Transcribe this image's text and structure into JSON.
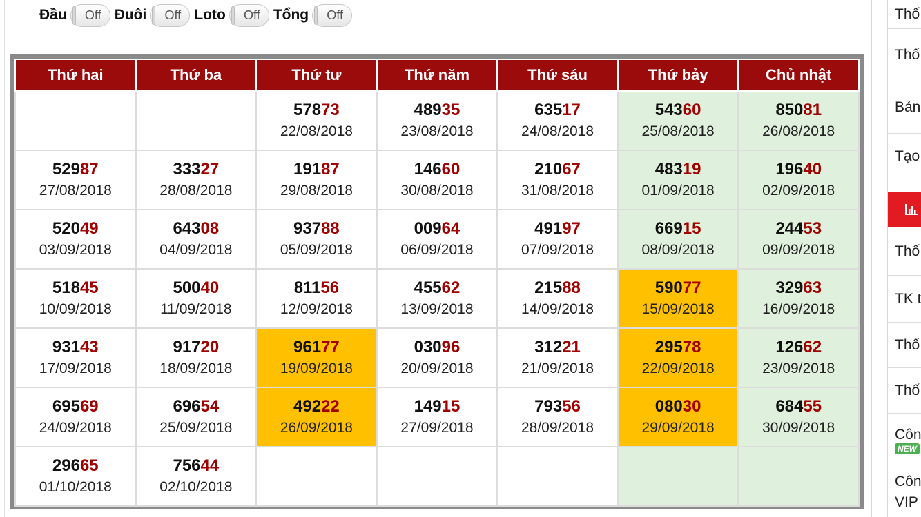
{
  "toggles": [
    {
      "label": "Đầu",
      "state": "Off"
    },
    {
      "label": "Đuôi",
      "state": "Off"
    },
    {
      "label": "Loto",
      "state": "Off"
    },
    {
      "label": "Tổng",
      "state": "Off"
    }
  ],
  "calendar": {
    "headers": [
      "Thứ hai",
      "Thứ ba",
      "Thứ tư",
      "Thứ năm",
      "Thứ sáu",
      "Thứ bảy",
      "Chủ nhật"
    ],
    "colors": {
      "header_bg": "#9b0b0b",
      "weekend_bg": "#dff0dc",
      "highlight_bg": "#ffc000",
      "tail_color": "#a00000"
    },
    "rows": [
      [
        null,
        null,
        {
          "head": "578",
          "tail": "73",
          "date": "22/08/2018"
        },
        {
          "head": "489",
          "tail": "35",
          "date": "23/08/2018"
        },
        {
          "head": "635",
          "tail": "17",
          "date": "24/08/2018"
        },
        {
          "head": "543",
          "tail": "60",
          "date": "25/08/2018"
        },
        {
          "head": "850",
          "tail": "81",
          "date": "26/08/2018"
        }
      ],
      [
        {
          "head": "529",
          "tail": "87",
          "date": "27/08/2018"
        },
        {
          "head": "333",
          "tail": "27",
          "date": "28/08/2018"
        },
        {
          "head": "191",
          "tail": "87",
          "date": "29/08/2018"
        },
        {
          "head": "146",
          "tail": "60",
          "date": "30/08/2018"
        },
        {
          "head": "210",
          "tail": "67",
          "date": "31/08/2018"
        },
        {
          "head": "483",
          "tail": "19",
          "date": "01/09/2018"
        },
        {
          "head": "196",
          "tail": "40",
          "date": "02/09/2018"
        }
      ],
      [
        {
          "head": "520",
          "tail": "49",
          "date": "03/09/2018"
        },
        {
          "head": "643",
          "tail": "08",
          "date": "04/09/2018"
        },
        {
          "head": "937",
          "tail": "88",
          "date": "05/09/2018"
        },
        {
          "head": "009",
          "tail": "64",
          "date": "06/09/2018"
        },
        {
          "head": "491",
          "tail": "97",
          "date": "07/09/2018"
        },
        {
          "head": "669",
          "tail": "15",
          "date": "08/09/2018"
        },
        {
          "head": "244",
          "tail": "53",
          "date": "09/09/2018"
        }
      ],
      [
        {
          "head": "518",
          "tail": "45",
          "date": "10/09/2018"
        },
        {
          "head": "500",
          "tail": "40",
          "date": "11/09/2018"
        },
        {
          "head": "811",
          "tail": "56",
          "date": "12/09/2018"
        },
        {
          "head": "455",
          "tail": "62",
          "date": "13/09/2018"
        },
        {
          "head": "215",
          "tail": "88",
          "date": "14/09/2018"
        },
        {
          "head": "590",
          "tail": "77",
          "date": "15/09/2018",
          "highlight": true
        },
        {
          "head": "329",
          "tail": "63",
          "date": "16/09/2018"
        }
      ],
      [
        {
          "head": "931",
          "tail": "43",
          "date": "17/09/2018"
        },
        {
          "head": "917",
          "tail": "20",
          "date": "18/09/2018"
        },
        {
          "head": "961",
          "tail": "77",
          "date": "19/09/2018",
          "highlight": true
        },
        {
          "head": "030",
          "tail": "96",
          "date": "20/09/2018"
        },
        {
          "head": "312",
          "tail": "21",
          "date": "21/09/2018"
        },
        {
          "head": "295",
          "tail": "78",
          "date": "22/09/2018",
          "highlight": true
        },
        {
          "head": "126",
          "tail": "62",
          "date": "23/09/2018"
        }
      ],
      [
        {
          "head": "695",
          "tail": "69",
          "date": "24/09/2018"
        },
        {
          "head": "696",
          "tail": "54",
          "date": "25/09/2018"
        },
        {
          "head": "492",
          "tail": "22",
          "date": "26/09/2018",
          "highlight": true
        },
        {
          "head": "149",
          "tail": "15",
          "date": "27/09/2018"
        },
        {
          "head": "793",
          "tail": "56",
          "date": "28/09/2018"
        },
        {
          "head": "080",
          "tail": "30",
          "date": "29/09/2018",
          "highlight": true
        },
        {
          "head": "684",
          "tail": "55",
          "date": "30/09/2018"
        }
      ],
      [
        {
          "head": "296",
          "tail": "65",
          "date": "01/10/2018"
        },
        {
          "head": "756",
          "tail": "44",
          "date": "02/10/2018"
        },
        null,
        null,
        null,
        null,
        null
      ]
    ]
  },
  "sidebar": {
    "items": [
      "Thố",
      "Thố",
      "Bản",
      "Tạo",
      "Thố",
      "TK t",
      "Thố",
      "Thố",
      "Côn",
      "Côn VIP"
    ],
    "new_badge": "NEW",
    "chart_icon": "bar-chart-icon"
  }
}
